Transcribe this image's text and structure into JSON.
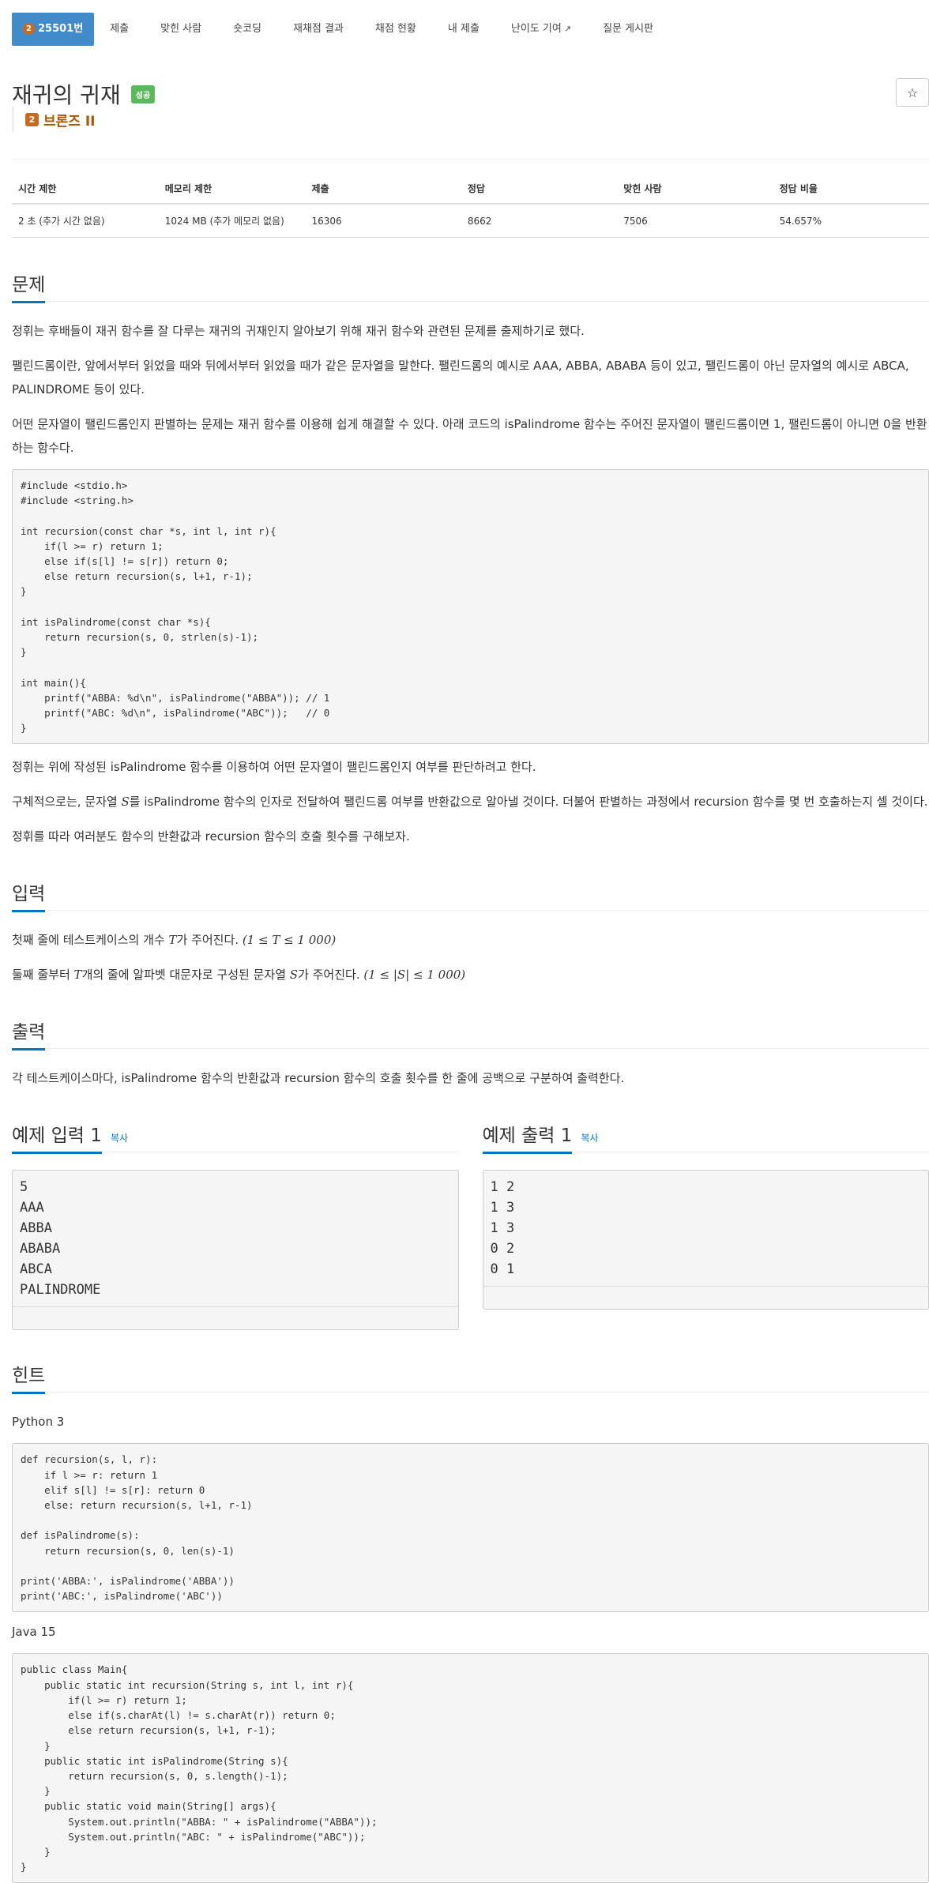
{
  "tabs": [
    {
      "label": "25501번",
      "badge": "2"
    },
    {
      "label": "제출"
    },
    {
      "label": "맞힌 사람"
    },
    {
      "label": "숏코딩"
    },
    {
      "label": "재채점 결과"
    },
    {
      "label": "채점 현황"
    },
    {
      "label": "내 제출"
    },
    {
      "label": "난이도 기여"
    },
    {
      "label": "질문 게시판"
    }
  ],
  "problem": {
    "title": "재귀의 귀재",
    "result_badge": "성공",
    "tier_label": "브론즈 II",
    "tier_badge": "2",
    "star": "☆"
  },
  "info": {
    "headers": [
      "시간 제한",
      "메모리 제한",
      "제출",
      "정답",
      "맞힌 사람",
      "정답 비율"
    ],
    "values": [
      "2 초 (추가 시간 없음)",
      "1024 MB (추가 메모리 없음)",
      "16306",
      "8662",
      "7506",
      "54.657%"
    ]
  },
  "sections": {
    "problem_heading": "문제",
    "p1": "정휘는 후배들이 재귀 함수를 잘 다루는 재귀의 귀재인지 알아보기 위해 재귀 함수와 관련된 문제를 출제하기로 했다.",
    "p2": "팰린드롬이란, 앞에서부터 읽었을 때와 뒤에서부터 읽었을 때가 같은 문자열을 말한다. 팰린드롬의 예시로 AAA, ABBA, ABABA 등이 있고, 팰린드롬이 아닌 문자열의 예시로 ABCA, PALINDROME 등이 있다.",
    "p3": "어떤 문자열이 팰린드롬인지 판별하는 문제는 재귀 함수를 이용해 쉽게 해결할 수 있다. 아래 코드의 isPalindrome 함수는 주어진 문자열이 팰린드롬이면 1, 팰린드롬이 아니면 0을 반환하는 함수다.",
    "code_c": "#include <stdio.h>\n#include <string.h>\n\nint recursion(const char *s, int l, int r){\n    if(l >= r) return 1;\n    else if(s[l] != s[r]) return 0;\n    else return recursion(s, l+1, r-1);\n}\n\nint isPalindrome(const char *s){\n    return recursion(s, 0, strlen(s)-1);\n}\n\nint main(){\n    printf(\"ABBA: %d\\n\", isPalindrome(\"ABBA\")); // 1\n    printf(\"ABC: %d\\n\", isPalindrome(\"ABC\"));   // 0\n}",
    "p4": "정휘는 위에 작성된 isPalindrome 함수를 이용하여 어떤 문자열이 팰린드롬인지 여부를 판단하려고 한다.",
    "p5_a": "구체적으로는, 문자열 ",
    "p5_var": "S",
    "p5_b": "를 isPalindrome 함수의 인자로 전달하여 팰린드롬 여부를 반환값으로 알아낼 것이다. 더불어 판별하는 과정에서 recursion 함수를 몇 번 호출하는지 셀 것이다.",
    "p6": "정휘를 따라 여러분도 함수의 반환값과 recursion 함수의 호출 횟수를 구해보자.",
    "input_heading": "입력",
    "in1_a": "첫째 줄에 테스트케이스의 개수 ",
    "in1_var": "T",
    "in1_b": "가 주어진다. ",
    "in1_math": "(1 ≤ T ≤ 1 000)",
    "in2_a": "둘째 줄부터 ",
    "in2_var": "T",
    "in2_b": "개의 줄에 알파벳 대문자로 구성된 문자열 ",
    "in2_var2": "S",
    "in2_c": "가 주어진다. ",
    "in2_math": "(1 ≤ |S| ≤ 1 000)",
    "output_heading": "출력",
    "out1": "각 테스트케이스마다, isPalindrome 함수의 반환값과 recursion 함수의 호출 횟수를 한 줄에 공백으로 구분하여 출력한다.",
    "sample_in_heading": "예제 입력 1",
    "sample_out_heading": "예제 출력 1",
    "copy_label": "복사",
    "sample_in": "5\nAAA\nABBA\nABABA\nABCA\nPALINDROME",
    "sample_out": "1 2\n1 3\n1 3\n0 2\n0 1",
    "hint_heading": "힌트",
    "lang1": "Python 3",
    "code_py": "def recursion(s, l, r):\n    if l >= r: return 1\n    elif s[l] != s[r]: return 0\n    else: return recursion(s, l+1, r-1)\n\ndef isPalindrome(s):\n    return recursion(s, 0, len(s)-1)\n\nprint('ABBA:', isPalindrome('ABBA'))\nprint('ABC:', isPalindrome('ABC'))",
    "lang2": "Java 15",
    "code_java": "public class Main{\n    public static int recursion(String s, int l, int r){\n        if(l >= r) return 1;\n        else if(s.charAt(l) != s.charAt(r)) return 0;\n        else return recursion(s, l+1, r-1);\n    }\n    public static int isPalindrome(String s){\n        return recursion(s, 0, s.length()-1);\n    }\n    public static void main(String[] args){\n        System.out.println(\"ABBA: \" + isPalindrome(\"ABBA\"));\n        System.out.println(\"ABC: \" + isPalindrome(\"ABC\"));\n    }\n}"
  }
}
